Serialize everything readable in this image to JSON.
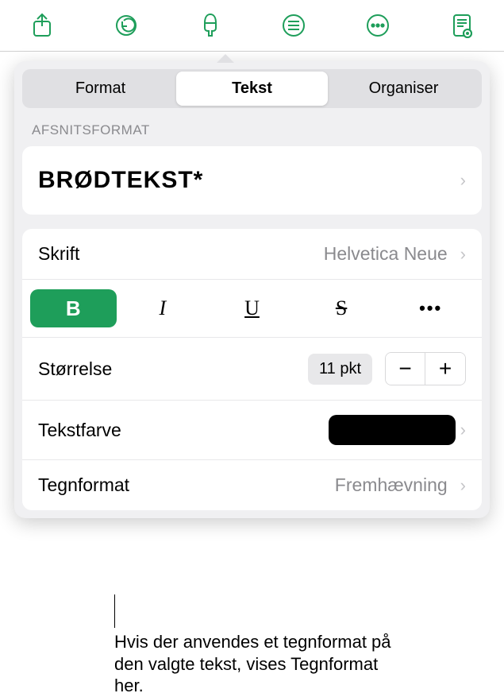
{
  "toolbar": {
    "icons": [
      "share",
      "undo",
      "format",
      "list",
      "more",
      "document"
    ]
  },
  "tabs": {
    "format": "Format",
    "text": "Tekst",
    "organize": "Organiser"
  },
  "section_label": "AFSNITSFORMAT",
  "paragraph_style": "BRØDTEKST*",
  "font": {
    "label": "Skrift",
    "value": "Helvetica Neue"
  },
  "format_buttons": {
    "bold": "B",
    "italic": "I",
    "underline": "U",
    "strike": "S",
    "more": "•••"
  },
  "size": {
    "label": "Størrelse",
    "value": "11 pkt",
    "minus": "−",
    "plus": "+"
  },
  "text_color": {
    "label": "Tekstfarve",
    "value": "#000000"
  },
  "char_style": {
    "label": "Tegnformat",
    "value": "Fremhævning"
  },
  "callout": "Hvis der anvendes et tegnformat på den valgte tekst, vises Tegnformat her."
}
